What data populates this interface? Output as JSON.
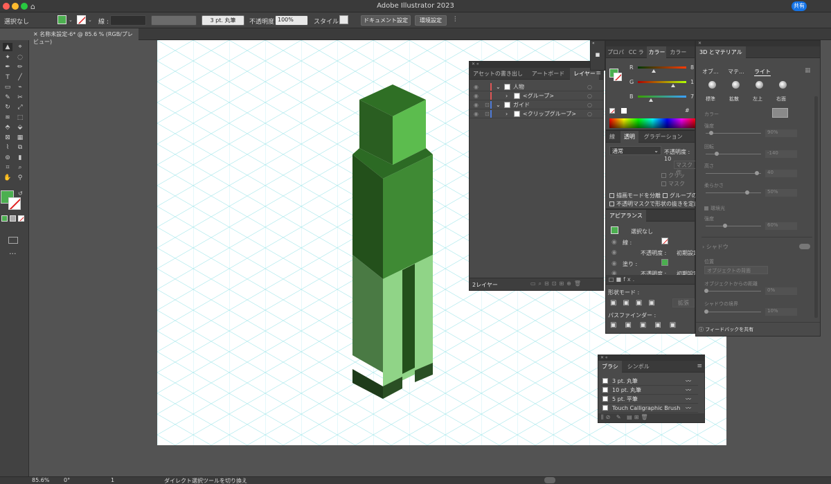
{
  "app": {
    "title": "Adobe Illustrator 2023",
    "share_label": "共有"
  },
  "control_bar": {
    "selection": "選択なし",
    "stroke_label": "線 :",
    "brush": "3 pt. 丸筆",
    "opacity_label": "不透明度 :",
    "opacity_value": "100%",
    "style_label": "スタイル :",
    "doc_settings": "ドキュメント設定",
    "prefs": "環境設定"
  },
  "document_tab": {
    "title": "名称未設定-6* @ 85.6 % (RGB/プレビュー)"
  },
  "layers_panel": {
    "tabs": [
      "アセットの書き出し",
      "アートボード",
      "レイヤー"
    ],
    "active_tab": 2,
    "rows": [
      {
        "name": "人物",
        "indent": 0,
        "color": "#e05656"
      },
      {
        "name": "<グループ>",
        "indent": 1,
        "color": "#e05656"
      },
      {
        "name": "ガイド",
        "indent": 0,
        "color": "#4f7bd8"
      },
      {
        "name": "<クリップグループ>",
        "indent": 1,
        "color": "#4f7bd8"
      }
    ],
    "footer": "2レイヤー"
  },
  "side_tabs": [
    "プロパ",
    "CC ラ",
    "カラー",
    "カラー"
  ],
  "color_panel": {
    "channels": [
      {
        "label": "R",
        "value": "8",
        "level": 0.33
      },
      {
        "label": "G",
        "value": "1",
        "level": 0.73
      },
      {
        "label": "B",
        "value": "7",
        "level": 0.27
      }
    ],
    "hex_symbol": "#"
  },
  "transparency_panel": {
    "tabs": [
      "線",
      "透明",
      "グラデーション"
    ],
    "blend_mode": "通常",
    "opacity_label": "不透明度 : 10",
    "mask_button": "マスク作",
    "clip": "クリッ",
    "invert": "マスク",
    "isolate_blend": "描画モードを分離",
    "knockout": "グループの",
    "opacity_mask": "不透明マスクで形状の抜きを定義"
  },
  "appearance_panel": {
    "title": "アピアランス",
    "none": "選択なし",
    "stroke": "線 :",
    "stroke_opacity": "不透明度 :",
    "stroke_opacity_value": "初期設定",
    "fill": "塗り :",
    "fill_opacity": "不透明度 :",
    "fill_opacity_value": "初期設定"
  },
  "pathfinder_panel": {
    "shape_modes": "形状モード :",
    "expand": "拡張",
    "pathfinders": "パスファインダー :"
  },
  "material_panel": {
    "title": "3D とマテリアル",
    "tabs": [
      "オブ...",
      "マテ...",
      "ライト"
    ],
    "presets": [
      "標準",
      "拡散",
      "左上",
      "右面"
    ],
    "color_label": "カラー",
    "intensity": "強度",
    "intensity_value": "90%",
    "rotation": "回転",
    "rotation_value": "-140",
    "height": "高さ",
    "height_value": "40",
    "softness": "柔らかさ",
    "softness_value": "50%",
    "ambient": "環境光",
    "ambient_intensity": "強度",
    "ambient_value": "60%",
    "shadow": "シャドウ",
    "position": "位置",
    "position_value": "オブジェクトの背面",
    "distance": "オブジェクトからの距離",
    "distance_value": "0%",
    "shadow_bounds": "シャドウの境界",
    "bounds_value": "10%",
    "feedback": "フィードバックを共有"
  },
  "brushes_panel": {
    "tabs": [
      "ブラシ",
      "シンボル"
    ],
    "items": [
      "3 pt. 丸筆",
      "10 pt. 丸筆",
      "5 pt. 平筆",
      "Touch Calligraphic Brush"
    ]
  },
  "status_bar": {
    "zoom": "85.6%",
    "angle": "0°",
    "artboard": "1",
    "tool_hint": "ダイレクト選択ツールを切り換え"
  },
  "colors": {
    "head_top": "#2f6f25",
    "head_front": "#5cbc4e",
    "body_left": "#23501b",
    "body_right": "#3f8a34",
    "legs_left": "#4a7a44",
    "legs_right": "#90d487",
    "feet": "#1e3b1a",
    "grid": "#a8e8ec",
    "fill_swatch": "#4caf50"
  }
}
